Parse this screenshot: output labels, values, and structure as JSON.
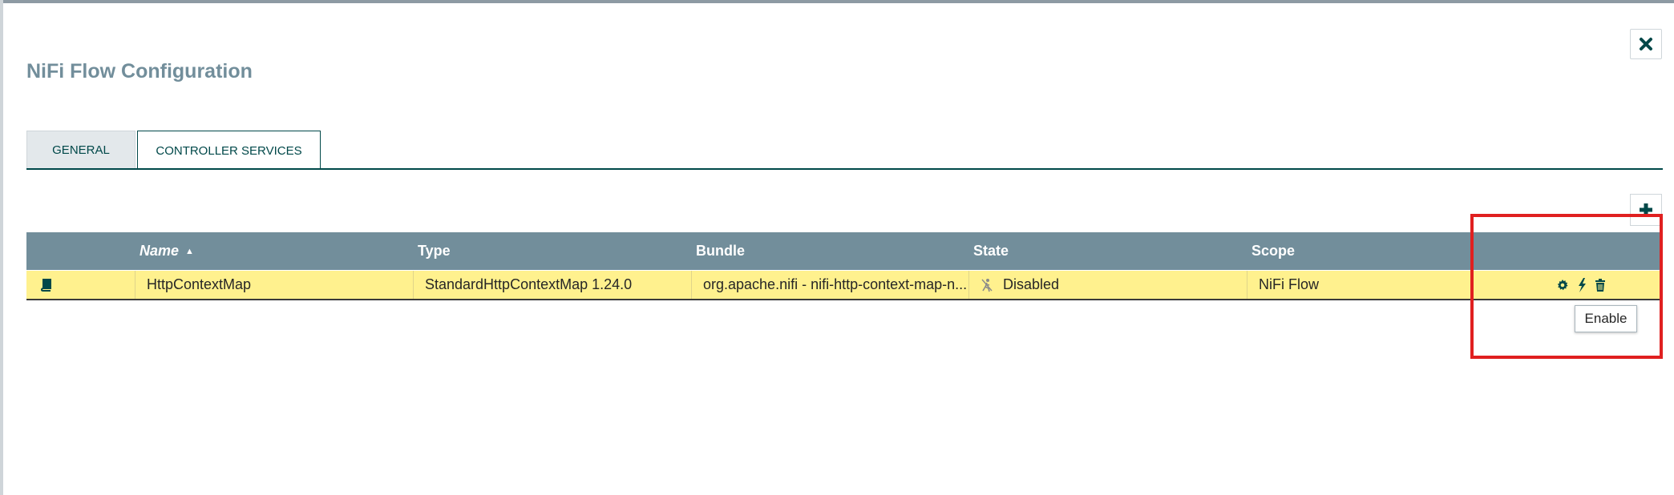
{
  "dialog": {
    "title": "NiFi Flow Configuration",
    "close_icon": "close-icon"
  },
  "tabs": [
    {
      "label": "General",
      "active": false
    },
    {
      "label": "Controller Services",
      "active": true
    }
  ],
  "toolbar": {
    "add_icon": "plus-icon"
  },
  "table": {
    "columns": [
      "Name",
      "Type",
      "Bundle",
      "State",
      "Scope"
    ],
    "sort_column": "Name",
    "rows": [
      {
        "icon": "book-icon",
        "name": "HttpContextMap",
        "type": "StandardHttpContextMap 1.24.0",
        "bundle": "org.apache.nifi - nifi-http-context-map-n...",
        "state": "Disabled",
        "scope": "NiFi Flow",
        "actions": [
          "gear-icon",
          "bolt-icon",
          "trash-icon"
        ]
      }
    ]
  },
  "tooltip": "Enable",
  "colors": {
    "header": "#728e9b",
    "row_highlight": "#fff18e",
    "accent": "#004849",
    "annotation": "#e02020"
  }
}
